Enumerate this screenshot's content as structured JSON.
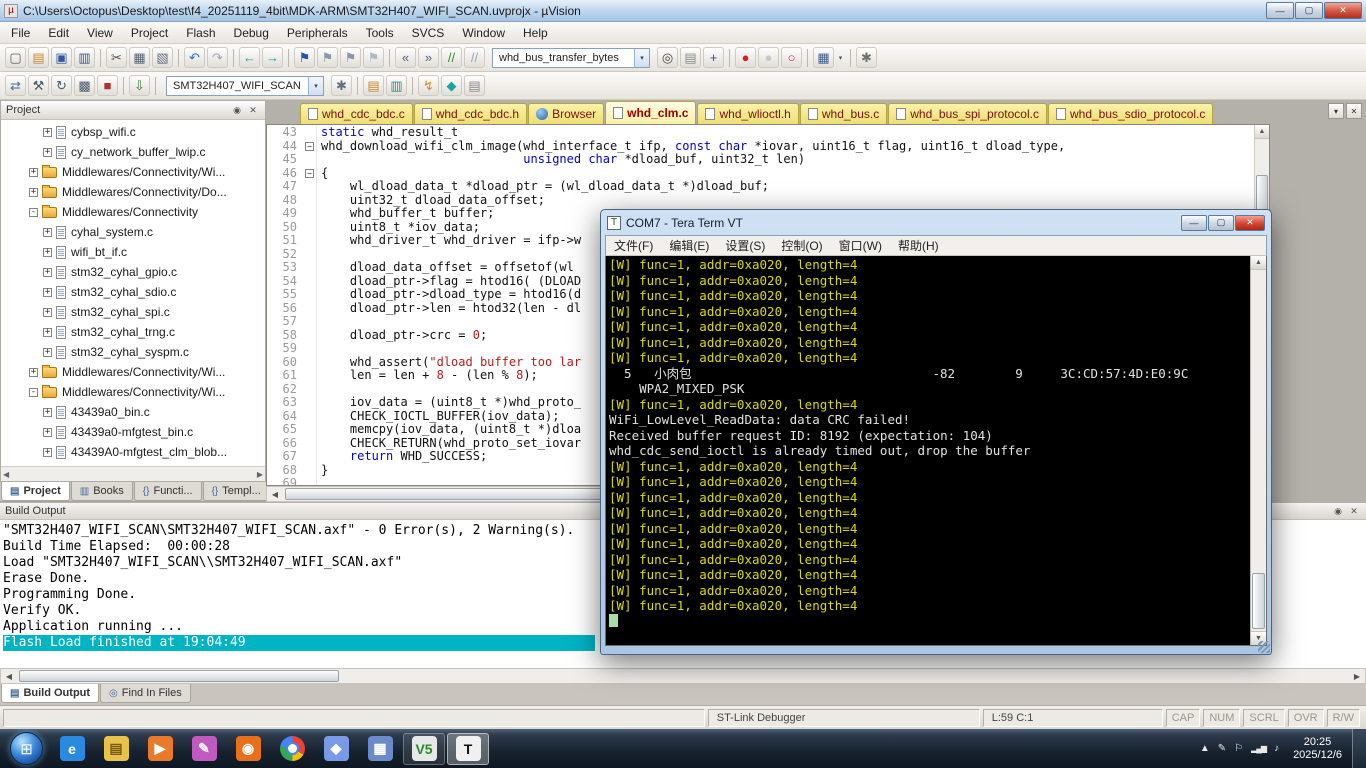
{
  "window": {
    "title": "C:\\Users\\Octopus\\Desktop\\test\\f4_20251119_4bit\\MDK-ARM\\SMT32H407_WIFI_SCAN.uvprojx - µVision"
  },
  "icons": {
    "minimize": "—",
    "restore": "▢",
    "close": "✕",
    "dropdown": "▾",
    "pin": "◉",
    "scroll_up": "▲",
    "scroll_down": "▼",
    "scroll_left": "◀",
    "scroll_right": "▶"
  },
  "menu": {
    "items": [
      "File",
      "Edit",
      "View",
      "Project",
      "Flash",
      "Debug",
      "Peripherals",
      "Tools",
      "SVCS",
      "Window",
      "Help"
    ]
  },
  "toolbar1": {
    "combo_value": "whd_bus_transfer_bytes",
    "icons_before": [
      {
        "name": "new-file-icon",
        "glyph": "▢",
        "color": "#606060"
      },
      {
        "name": "open-file-icon",
        "glyph": "▤",
        "color": "#c8882a"
      },
      {
        "name": "save-icon",
        "glyph": "▣",
        "color": "#33569b"
      },
      {
        "name": "save-all-icon",
        "glyph": "▥",
        "color": "#33569b"
      },
      {
        "sep": true
      },
      {
        "name": "cut-icon",
        "glyph": "✂",
        "color": "#505050"
      },
      {
        "name": "copy-icon",
        "glyph": "▦",
        "color": "#556070"
      },
      {
        "name": "paste-icon",
        "glyph": "▧",
        "color": "#667080"
      },
      {
        "sep": true
      },
      {
        "name": "undo-icon",
        "glyph": "↶",
        "color": "#2a6fbf"
      },
      {
        "name": "redo-icon",
        "glyph": "↷",
        "color": "#98a4b4"
      },
      {
        "sep": true
      },
      {
        "name": "navigate-back-icon",
        "glyph": "←",
        "color": "#18a0a8"
      },
      {
        "name": "navigate-forward-icon",
        "glyph": "→",
        "color": "#18a0a8"
      },
      {
        "sep": true
      },
      {
        "name": "bookmark-toggle-icon",
        "glyph": "⚑",
        "color": "#2255aa"
      },
      {
        "name": "bookmark-prev-icon",
        "glyph": "⚑",
        "color": "#8898a8"
      },
      {
        "name": "bookmark-next-icon",
        "glyph": "⚑",
        "color": "#8898a8"
      },
      {
        "name": "bookmark-clear-icon",
        "glyph": "⚑",
        "color": "#b0b8c0"
      },
      {
        "sep": true
      },
      {
        "name": "unindent-icon",
        "glyph": "«",
        "color": "#506080"
      },
      {
        "name": "indent-icon",
        "glyph": "»",
        "color": "#506080"
      },
      {
        "name": "comment-icon",
        "glyph": "//",
        "color": "#3a8a3a"
      },
      {
        "name": "uncomment-icon",
        "glyph": "//",
        "color": "#9aa4ae"
      }
    ],
    "icons_after": [
      {
        "name": "find-in-files-icon",
        "glyph": "◎",
        "color": "#444444"
      },
      {
        "name": "browse-book-icon",
        "glyph": "▤",
        "color": "#888888"
      },
      {
        "name": "zoom-in-icon",
        "glyph": "+",
        "color": "#2255aa"
      },
      {
        "sep": true
      },
      {
        "name": "toggle-breakpoint-icon",
        "glyph": "●",
        "color": "#cc2222"
      },
      {
        "name": "disable-breakpoint-icon",
        "glyph": "●",
        "color": "#c8c8c8"
      },
      {
        "name": "kill-breakpoints-icon",
        "glyph": "○",
        "color": "#cc2222"
      },
      {
        "sep": true
      },
      {
        "name": "display-format-icon",
        "glyph": "▦",
        "color": "#3a5a8a",
        "dropdown": true
      },
      {
        "sep": true
      },
      {
        "name": "configure-icon",
        "glyph": "✱",
        "color": "#707070"
      }
    ]
  },
  "toolbar2": {
    "target_value": "SMT32H407_WIFI_SCAN",
    "icons_before": [
      {
        "name": "translate-icon",
        "glyph": "⇄",
        "color": "#4a6a9a"
      },
      {
        "name": "build-icon",
        "glyph": "⚒",
        "color": "#4a5a6a"
      },
      {
        "name": "rebuild-icon",
        "glyph": "↻",
        "color": "#4a5a6a"
      },
      {
        "name": "batch-build-icon",
        "glyph": "▩",
        "color": "#4a5a6a"
      },
      {
        "name": "stop-build-icon",
        "glyph": "■",
        "color": "#b03030"
      },
      {
        "sep": true
      },
      {
        "name": "download-icon",
        "glyph": "⇩",
        "color": "#3a7a3a"
      },
      {
        "sep": true
      }
    ],
    "icons_after": [
      {
        "name": "target-options-icon",
        "glyph": "✱",
        "color": "#607080"
      },
      {
        "sep": true
      },
      {
        "name": "file-extensions-icon",
        "glyph": "▤",
        "color": "#c8882a"
      },
      {
        "name": "manage-runtime-icon",
        "glyph": "▥",
        "color": "#2a8a8a"
      },
      {
        "sep": true
      },
      {
        "name": "flash-download-icon",
        "glyph": "↯",
        "color": "#d88a20"
      },
      {
        "name": "pack-installer-icon",
        "glyph": "◆",
        "color": "#20a0a0"
      },
      {
        "name": "books-icon",
        "glyph": "▤",
        "color": "#888888"
      }
    ]
  },
  "project_panel": {
    "header": "Project",
    "tree": [
      {
        "l": "cybsp_wifi.c",
        "k": "file",
        "lv": 3,
        "e": "+"
      },
      {
        "l": "cy_network_buffer_lwip.c",
        "k": "file",
        "lv": 3,
        "e": "+"
      },
      {
        "l": "Middlewares/Connectivity/Wi...",
        "k": "folder",
        "lv": 2,
        "e": "+"
      },
      {
        "l": "Middlewares/Connectivity/Do...",
        "k": "folder",
        "lv": 2,
        "e": "+"
      },
      {
        "l": "Middlewares/Connectivity",
        "k": "folder",
        "lv": 2,
        "e": "-"
      },
      {
        "l": "cyhal_system.c",
        "k": "file",
        "lv": 3,
        "e": "+"
      },
      {
        "l": "wifi_bt_if.c",
        "k": "file",
        "lv": 3,
        "e": "+"
      },
      {
        "l": "stm32_cyhal_gpio.c",
        "k": "file",
        "lv": 3,
        "e": "+"
      },
      {
        "l": "stm32_cyhal_sdio.c",
        "k": "file",
        "lv": 3,
        "e": "+"
      },
      {
        "l": "stm32_cyhal_spi.c",
        "k": "file",
        "lv": 3,
        "e": "+"
      },
      {
        "l": "stm32_cyhal_trng.c",
        "k": "file",
        "lv": 3,
        "e": "+"
      },
      {
        "l": "stm32_cyhal_syspm.c",
        "k": "file",
        "lv": 3,
        "e": "+"
      },
      {
        "l": "Middlewares/Connectivity/Wi...",
        "k": "folder",
        "lv": 2,
        "e": "+"
      },
      {
        "l": "Middlewares/Connectivity/Wi...",
        "k": "folder",
        "lv": 2,
        "e": "-"
      },
      {
        "l": "43439a0_bin.c",
        "k": "file",
        "lv": 3,
        "e": "+"
      },
      {
        "l": "43439a0-mfgtest_bin.c",
        "k": "file",
        "lv": 3,
        "e": "+"
      },
      {
        "l": "43439A0-mfgtest_clm_blob...",
        "k": "file",
        "lv": 3,
        "e": "+"
      }
    ],
    "tabs": [
      {
        "label": "Project",
        "icon": "▤",
        "active": true
      },
      {
        "label": "Books",
        "icon": "▥",
        "active": false
      },
      {
        "label": "Functi...",
        "icon": "{}",
        "active": false
      },
      {
        "label": "Templ...",
        "icon": "{}",
        "active": false
      }
    ]
  },
  "editor": {
    "tabs": [
      {
        "label": "whd_cdc_bdc.c"
      },
      {
        "label": "whd_cdc_bdc.h"
      },
      {
        "label": "Browser",
        "icon": "browser"
      },
      {
        "label": "whd_clm.c",
        "active": true
      },
      {
        "label": "whd_wlioctl.h"
      },
      {
        "label": "whd_bus.c"
      },
      {
        "label": "whd_bus_spi_protocol.c"
      },
      {
        "label": "whd_bus_sdio_protocol.c"
      }
    ],
    "lines": [
      {
        "n": 43,
        "t": "static whd_result_t"
      },
      {
        "n": 44,
        "t": "whd_download_wifi_clm_image(whd_interface_t ifp, const char *iovar, uint16_t flag, uint16_t dload_type,",
        "f": "-"
      },
      {
        "n": 45,
        "t": "                            unsigned char *dload_buf, uint32_t len)"
      },
      {
        "n": 46,
        "t": "{",
        "f": "-"
      },
      {
        "n": 47,
        "t": "    wl_dload_data_t *dload_ptr = (wl_dload_data_t *)dload_buf;"
      },
      {
        "n": 48,
        "t": "    uint32_t dload_data_offset;"
      },
      {
        "n": 49,
        "t": "    whd_buffer_t buffer;"
      },
      {
        "n": 50,
        "t": "    uint8_t *iov_data;"
      },
      {
        "n": 51,
        "t": "    whd_driver_t whd_driver = ifp->w"
      },
      {
        "n": 52,
        "t": ""
      },
      {
        "n": 53,
        "t": "    dload_data_offset = offsetof(wl"
      },
      {
        "n": 54,
        "t": "    dload_ptr->flag = htod16( (DLOAD"
      },
      {
        "n": 55,
        "t": "    dload_ptr->dload_type = htod16(d"
      },
      {
        "n": 56,
        "t": "    dload_ptr->len = htod32(len - dl"
      },
      {
        "n": 57,
        "t": ""
      },
      {
        "n": 58,
        "t": "    dload_ptr->crc = 0;"
      },
      {
        "n": 59,
        "t": ""
      },
      {
        "n": 60,
        "t": "    whd_assert(\"dload buffer too lar"
      },
      {
        "n": 61,
        "t": "    len = len + 8 - (len % 8);"
      },
      {
        "n": 62,
        "t": ""
      },
      {
        "n": 63,
        "t": "    iov_data = (uint8_t *)whd_proto_"
      },
      {
        "n": 64,
        "t": "    CHECK_IOCTL_BUFFER(iov_data);"
      },
      {
        "n": 65,
        "t": "    memcpy(iov_data, (uint8_t *)dloa"
      },
      {
        "n": 66,
        "t": "    CHECK_RETURN(whd_proto_set_iovar"
      },
      {
        "n": 67,
        "t": "    return WHD_SUCCESS;"
      },
      {
        "n": 68,
        "t": "}"
      },
      {
        "n": 69,
        "t": ""
      }
    ]
  },
  "teraterm": {
    "title": "COM7 - Tera Term VT",
    "menu": [
      "文件(F)",
      "编辑(E)",
      "设置(S)",
      "控制(O)",
      "窗口(W)",
      "帮助(H)"
    ],
    "lines": [
      {
        "t": "[W] func=1, addr=0xa020, length=4",
        "c": "y"
      },
      {
        "t": "[W] func=1, addr=0xa020, length=4",
        "c": "y"
      },
      {
        "t": "[W] func=1, addr=0xa020, length=4",
        "c": "y"
      },
      {
        "t": "[W] func=1, addr=0xa020, length=4",
        "c": "y"
      },
      {
        "t": "[W] func=1, addr=0xa020, length=4",
        "c": "y"
      },
      {
        "t": "[W] func=1, addr=0xa020, length=4",
        "c": "y"
      },
      {
        "t": "[W] func=1, addr=0xa020, length=4",
        "c": "y"
      },
      {
        "t": "  5   小肉包                                -82        9     3C:CD:57:4D:E0:9C",
        "c": "w"
      },
      {
        "t": "    WPA2_MIXED_PSK",
        "c": "w"
      },
      {
        "t": "[W] func=1, addr=0xa020, length=4",
        "c": "y"
      },
      {
        "t": "WiFi_LowLevel_ReadData: data CRC failed!",
        "c": "w"
      },
      {
        "t": "Received buffer request ID: 8192 (expectation: 104)",
        "c": "w"
      },
      {
        "t": "whd_cdc_send_ioctl is already timed out, drop the buffer",
        "c": "w"
      },
      {
        "t": "[W] func=1, addr=0xa020, length=4",
        "c": "y"
      },
      {
        "t": "[W] func=1, addr=0xa020, length=4",
        "c": "y"
      },
      {
        "t": "[W] func=1, addr=0xa020, length=4",
        "c": "y"
      },
      {
        "t": "[W] func=1, addr=0xa020, length=4",
        "c": "y"
      },
      {
        "t": "[W] func=1, addr=0xa020, length=4",
        "c": "y"
      },
      {
        "t": "[W] func=1, addr=0xa020, length=4",
        "c": "y"
      },
      {
        "t": "[W] func=1, addr=0xa020, length=4",
        "c": "y"
      },
      {
        "t": "[W] func=1, addr=0xa020, length=4",
        "c": "y"
      },
      {
        "t": "[W] func=1, addr=0xa020, length=4",
        "c": "y"
      },
      {
        "t": "[W] func=1, addr=0xa020, length=4",
        "c": "y"
      }
    ]
  },
  "build_output": {
    "header": "Build Output",
    "lines": [
      {
        "t": "\"SMT32H407_WIFI_SCAN\\SMT32H407_WIFI_SCAN.axf\" - 0 Error(s), 2 Warning(s)."
      },
      {
        "t": "Build Time Elapsed:  00:00:28"
      },
      {
        "t": "Load \"SMT32H407_WIFI_SCAN\\\\SMT32H407_WIFI_SCAN.axf\""
      },
      {
        "t": "Erase Done."
      },
      {
        "t": "Programming Done."
      },
      {
        "t": "Verify OK."
      },
      {
        "t": "Application running ..."
      },
      {
        "t": "Flash Load finished at 19:04:49",
        "highlight": true
      }
    ]
  },
  "panel_tabs": [
    {
      "label": "Build Output",
      "icon": "▤",
      "active": true
    },
    {
      "label": "Find In Files",
      "icon": "◎",
      "active": false
    }
  ],
  "status_bar": {
    "debugger": "ST-Link Debugger",
    "cursor": "L:59 C:1",
    "flags": [
      "CAP",
      "NUM",
      "SCRL",
      "OVR",
      "R/W"
    ]
  },
  "taskbar": {
    "items": [
      {
        "name": "start-button",
        "glyph": "⊞"
      },
      {
        "name": "internet-explorer",
        "glyph": "e",
        "color": "#2a8ae0"
      },
      {
        "name": "file-explorer",
        "glyph": "▤",
        "color": "#e8c24a",
        "fg": "#7a5a10"
      },
      {
        "name": "media-player",
        "glyph": "▶",
        "color": "#e87a2a"
      },
      {
        "name": "paint",
        "glyph": "✎",
        "color": "#c05ac0"
      },
      {
        "name": "firefox",
        "glyph": "◉",
        "color": "#e8701a"
      },
      {
        "name": "chrome",
        "glyph": "",
        "color": ""
      },
      {
        "name": "visual-studio",
        "glyph": "◆",
        "color": "#7a9ae8"
      },
      {
        "name": "calculator",
        "glyph": "▦",
        "color": "#6a8ac8"
      },
      {
        "name": "keil-uvision",
        "glyph": "V5",
        "color": "#e8e8e8",
        "fg": "#2a8a2a",
        "open": true
      },
      {
        "name": "tera-term",
        "glyph": "T",
        "color": "#f0f0f0",
        "fg": "#111111",
        "active": true
      }
    ],
    "tray_icons": [
      {
        "name": "tray-expand-icon",
        "glyph": "▲"
      },
      {
        "name": "pen-input-icon",
        "glyph": "✎"
      },
      {
        "name": "action-center-icon",
        "glyph": "⚐"
      },
      {
        "name": "network-icon",
        "glyph": "▂▄▆"
      },
      {
        "name": "volume-icon",
        "glyph": "♪"
      }
    ],
    "time": "20:25",
    "date": "2025/12/6"
  }
}
